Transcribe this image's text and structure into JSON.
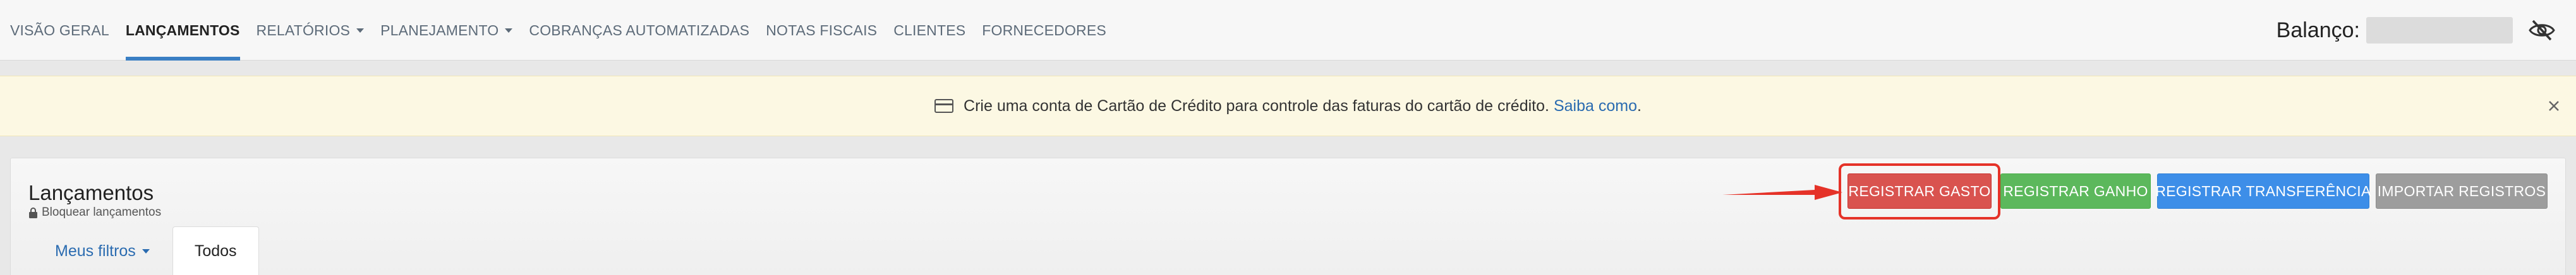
{
  "nav": {
    "items": [
      {
        "label": "VISÃO GERAL",
        "active": false,
        "dropdown": false
      },
      {
        "label": "LANÇAMENTOS",
        "active": true,
        "dropdown": false
      },
      {
        "label": "RELATÓRIOS",
        "active": false,
        "dropdown": true
      },
      {
        "label": "PLANEJAMENTO",
        "active": false,
        "dropdown": true
      },
      {
        "label": "COBRANÇAS AUTOMATIZADAS",
        "active": false,
        "dropdown": false
      },
      {
        "label": "NOTAS FISCAIS",
        "active": false,
        "dropdown": false
      },
      {
        "label": "CLIENTES",
        "active": false,
        "dropdown": false
      },
      {
        "label": "FORNECEDORES",
        "active": false,
        "dropdown": false
      }
    ],
    "balance_label": "Balanço:",
    "balance_icon": "eye-slash-icon"
  },
  "notice": {
    "icon": "credit-card-icon",
    "text": "Crie uma conta de Cartão de Crédito para controle das faturas do cartão de crédito.",
    "link": "Saiba como",
    "period": "."
  },
  "panel": {
    "title": "Lançamentos",
    "lock_label": "Bloquear lançamentos",
    "tabs": {
      "filters": "Meus filtros",
      "all": "Todos"
    },
    "buttons": {
      "expense": "REGISTRAR GASTO",
      "income": "REGISTRAR GANHO",
      "transfer": "REGISTRAR TRANSFERÊNCIA",
      "import": "IMPORTAR REGISTROS"
    }
  },
  "colors": {
    "expense": "#d9534f",
    "income": "#5cb85c",
    "transfer": "#3d8ee8",
    "import": "#9d9d9d",
    "highlight": "#e53228",
    "active_underline": "#3a7fc4",
    "notice_bg": "#fcf8e3"
  }
}
